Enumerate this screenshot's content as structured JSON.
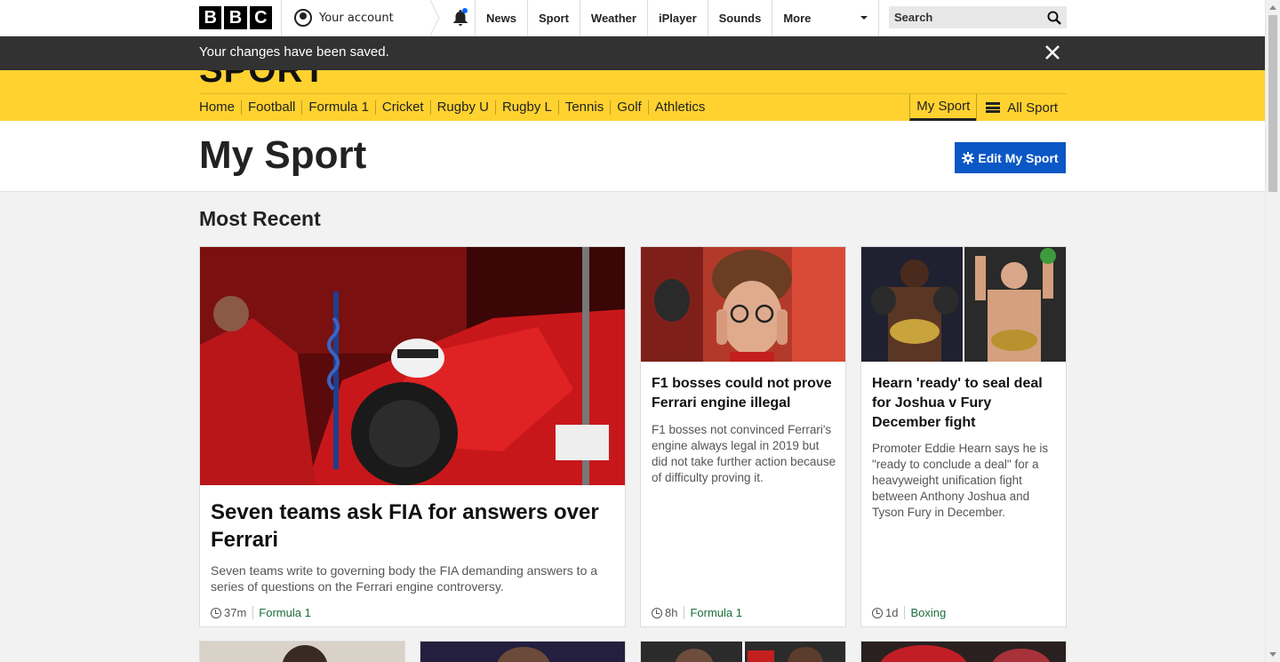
{
  "topnav": {
    "logo_letters": [
      "B",
      "B",
      "C"
    ],
    "account_label": "Your account",
    "links": [
      "News",
      "Sport",
      "Weather",
      "iPlayer",
      "Sounds"
    ],
    "more_label": "More",
    "search_placeholder": "Search"
  },
  "banner": {
    "message": "Your changes have been saved."
  },
  "sport": {
    "logo_text": "SPORT",
    "nav_items": [
      "Home",
      "Football",
      "Formula 1",
      "Cricket",
      "Rugby U",
      "Rugby L",
      "Tennis",
      "Golf",
      "Athletics"
    ],
    "my_sport_tab": "My Sport",
    "all_sport": "All Sport"
  },
  "page": {
    "title": "My Sport",
    "edit_button": "Edit My Sport",
    "section_title": "Most Recent"
  },
  "cards": [
    {
      "headline": "Seven teams ask FIA for answers over Ferrari",
      "summary": "Seven teams write to governing body the FIA demanding answers to a series of questions on the Ferrari engine controversy.",
      "time": "37m",
      "tag": "Formula 1"
    },
    {
      "headline": "F1 bosses could not prove Ferrari engine illegal",
      "summary": "F1 bosses not convinced Ferrari's engine always legal in 2019 but did not take further action because of difficulty proving it.",
      "time": "8h",
      "tag": "Formula 1"
    },
    {
      "headline": "Hearn 'ready' to seal deal for Joshua v Fury December fight",
      "summary": "Promoter Eddie Hearn says he is \"ready to conclude a deal\" for a heavyweight unification fight between Anthony Joshua and Tyson Fury in December.",
      "time": "1d",
      "tag": "Boxing"
    }
  ],
  "colors": {
    "sport_yellow": "#ffd230",
    "banner_bg": "#323232",
    "edit_button_bg": "#0b57c5",
    "tag_green": "#1a6d3b"
  }
}
